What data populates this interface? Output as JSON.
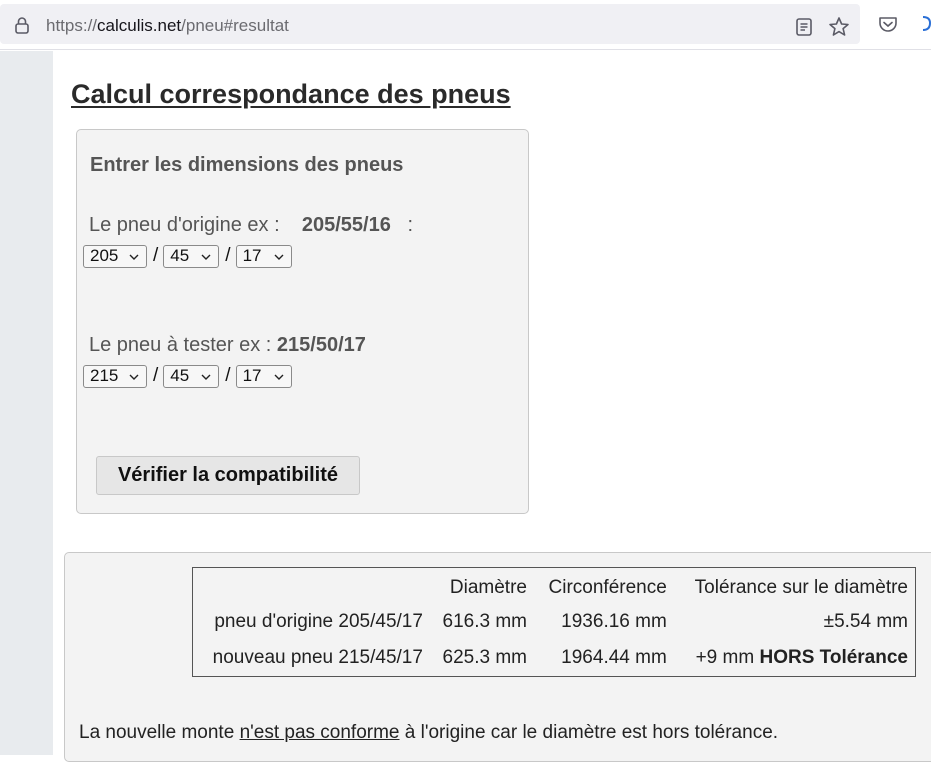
{
  "browser": {
    "url_scheme": "https://",
    "url_host": "calculis.net",
    "url_path": "/pneu#resultat"
  },
  "page": {
    "title": "Calcul correspondance des pneus"
  },
  "form": {
    "heading": "Entrer les dimensions des pneus",
    "original": {
      "label": "Le pneu d'origine ex :",
      "example": "205/55/16",
      "suffix": ":",
      "width": "205",
      "ratio": "45",
      "rim": "17"
    },
    "test": {
      "label": "Le pneu à tester ex :",
      "example": "215/50/17",
      "width": "215",
      "ratio": "45",
      "rim": "17"
    },
    "separator": "/",
    "button_label": "Vérifier la compatibilité"
  },
  "results": {
    "headers": [
      "",
      "Diamètre",
      "Circonférence",
      "Tolérance sur le diamètre"
    ],
    "rows": [
      {
        "label": "pneu d'origine 205/45/17",
        "diameter": "616.3 mm",
        "circumference": "1936.16 mm",
        "tolerance": "±5.54 mm",
        "status": ""
      },
      {
        "label": "nouveau pneu 215/45/17",
        "diameter": "625.3 mm",
        "circumference": "1964.44 mm",
        "tolerance": "+9 mm",
        "status": "HORS Tolérance"
      }
    ],
    "sentence_before": "La nouvelle monte ",
    "sentence_emph": "n'est pas conforme",
    "sentence_after": " à l'origine car le diamètre est hors tolérance."
  },
  "icons": {
    "lock": "lock-icon",
    "reader": "reader-view-icon",
    "bookmark": "star-icon",
    "pocket": "pocket-icon",
    "extension": "extension-icon",
    "dropdown": "chevron-down-icon"
  },
  "colors": {
    "panel_bg": "#f3f3f3",
    "panel_border": "#c8c8c8",
    "sidebar_bg": "#e8ebee"
  }
}
